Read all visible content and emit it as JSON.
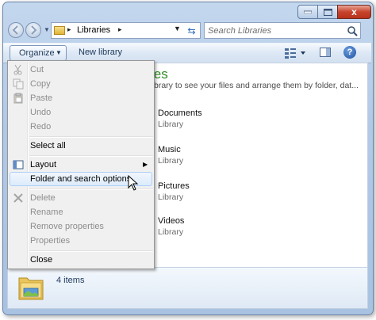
{
  "window": {
    "caption": {
      "minimize": "",
      "maximize": "",
      "close": "x"
    }
  },
  "address": {
    "breadcrumb": "Libraries",
    "separator": "▸"
  },
  "search": {
    "placeholder": "Search Libraries"
  },
  "toolbar": {
    "organize_label": "Organize",
    "new_library_label": "New library",
    "help_label": "?"
  },
  "content": {
    "title": "ies",
    "subtitle": "brary to see your files and arrange them by folder, dat...",
    "libraries": [
      {
        "name": "Documents",
        "type": "Library"
      },
      {
        "name": "Music",
        "type": "Library"
      },
      {
        "name": "Pictures",
        "type": "Library"
      },
      {
        "name": "Videos",
        "type": "Library"
      }
    ]
  },
  "details": {
    "item_count": "4 items"
  },
  "organize_menu": {
    "items": [
      {
        "label": "Cut",
        "enabled": false,
        "icon": "scissors-icon"
      },
      {
        "label": "Copy",
        "enabled": false,
        "icon": "copy-icon"
      },
      {
        "label": "Paste",
        "enabled": false,
        "icon": "paste-icon"
      },
      {
        "label": "Undo",
        "enabled": false
      },
      {
        "label": "Redo",
        "enabled": false
      },
      {
        "label": "Select all",
        "enabled": true
      },
      {
        "label": "Layout",
        "enabled": true,
        "icon": "layout-icon",
        "submenu": true
      },
      {
        "label": "Folder and search options",
        "enabled": true,
        "highlighted": true
      },
      {
        "label": "Delete",
        "enabled": false,
        "icon": "delete-x-icon"
      },
      {
        "label": "Rename",
        "enabled": false
      },
      {
        "label": "Remove properties",
        "enabled": false
      },
      {
        "label": "Properties",
        "enabled": false
      },
      {
        "label": "Close",
        "enabled": true
      }
    ]
  },
  "colors": {
    "accent_green": "#2e8b23",
    "menu_highlight": "#dcebfb",
    "disabled_text": "#8d8d8d"
  }
}
